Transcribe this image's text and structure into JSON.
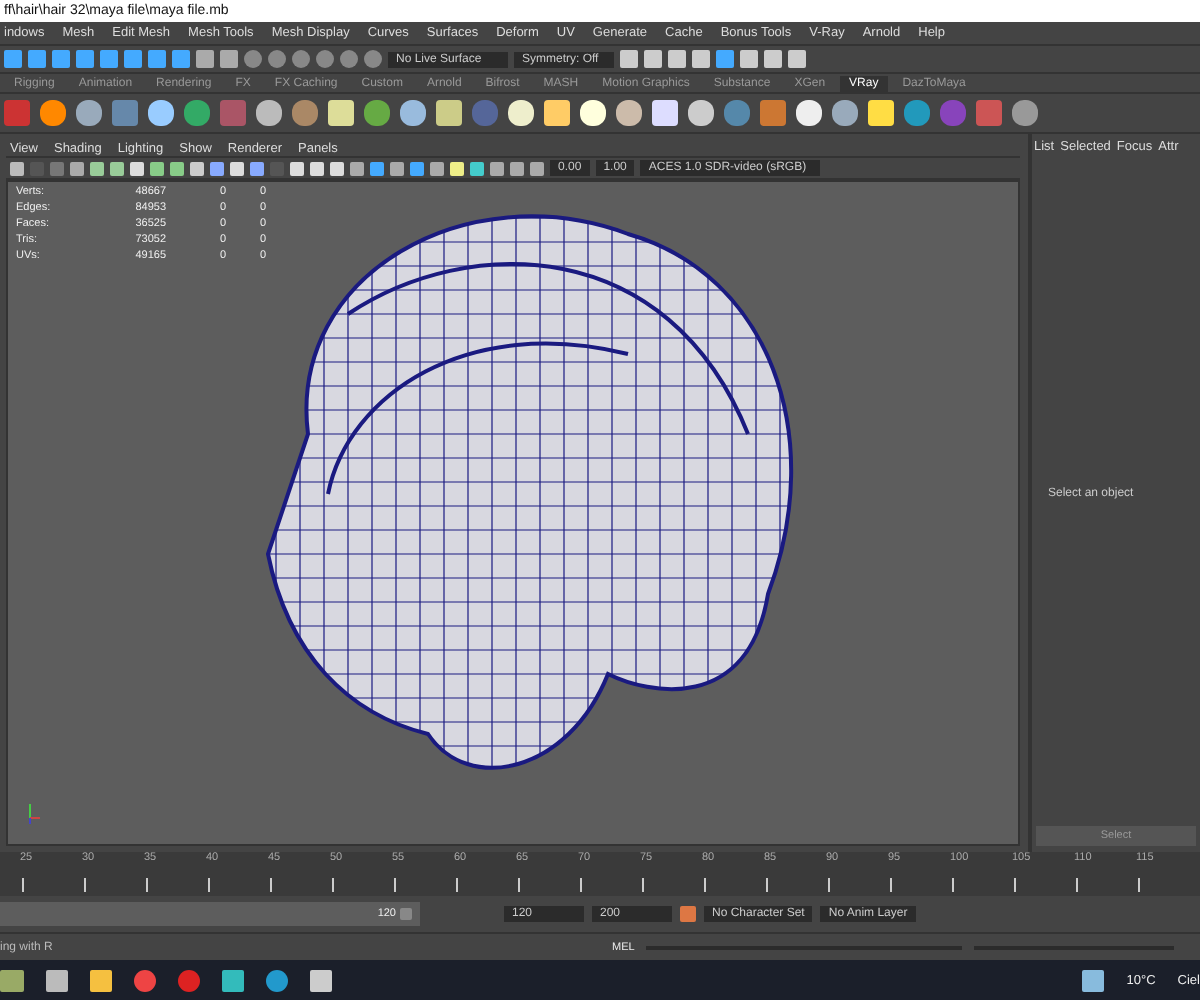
{
  "window": {
    "title": "ff\\hair\\hair 32\\maya file\\maya file.mb"
  },
  "menu": [
    "indows",
    "Mesh",
    "Edit Mesh",
    "Mesh Tools",
    "Mesh Display",
    "Curves",
    "Surfaces",
    "Deform",
    "UV",
    "Generate",
    "Cache",
    "Bonus Tools",
    "V-Ray",
    "Arnold",
    "Help"
  ],
  "status_line": {
    "live_surface": "No Live Surface",
    "symmetry": "Symmetry: Off"
  },
  "shelf_tabs": [
    {
      "label": "Rigging",
      "selected": false
    },
    {
      "label": "Animation",
      "selected": false
    },
    {
      "label": "Rendering",
      "selected": false
    },
    {
      "label": "FX",
      "selected": false
    },
    {
      "label": "FX Caching",
      "selected": false
    },
    {
      "label": "Custom",
      "selected": false
    },
    {
      "label": "Arnold",
      "selected": false
    },
    {
      "label": "Bifrost",
      "selected": false
    },
    {
      "label": "MASH",
      "selected": false
    },
    {
      "label": "Motion Graphics",
      "selected": false
    },
    {
      "label": "Substance",
      "selected": false
    },
    {
      "label": "XGen",
      "selected": false
    },
    {
      "label": "VRay",
      "selected": true
    },
    {
      "label": "DazToMaya",
      "selected": false
    }
  ],
  "viewport": {
    "menu": [
      "View",
      "Shading",
      "Lighting",
      "Show",
      "Renderer",
      "Panels"
    ],
    "exposure": "0.00",
    "gamma": "1.00",
    "color_space": "ACES 1.0 SDR-video (sRGB)",
    "stats": [
      {
        "label": "Verts:",
        "values": [
          "48667",
          "0",
          "0"
        ]
      },
      {
        "label": "Edges:",
        "values": [
          "84953",
          "0",
          "0"
        ]
      },
      {
        "label": "Faces:",
        "values": [
          "36525",
          "0",
          "0"
        ]
      },
      {
        "label": "Tris:",
        "values": [
          "73052",
          "0",
          "0"
        ]
      },
      {
        "label": "UVs:",
        "values": [
          "49165",
          "0",
          "0"
        ]
      }
    ]
  },
  "channel_box": {
    "tabs": [
      "List",
      "Selected",
      "Focus",
      "Attr"
    ],
    "message": "Select an object",
    "button": "Select"
  },
  "time_slider": {
    "ticks": [
      "25",
      "30",
      "35",
      "40",
      "45",
      "50",
      "55",
      "60",
      "65",
      "70",
      "75",
      "80",
      "85",
      "90",
      "95",
      "100",
      "105",
      "110",
      "115"
    ]
  },
  "range_slider": {
    "level": 1,
    "range_end": "120",
    "end": "120",
    "max": "200",
    "character_set": "No Character Set",
    "anim_layer": "No Anim Layer"
  },
  "command_line": {
    "help": "ing with R",
    "language": "MEL"
  },
  "taskbar": {
    "temperature": "10°C",
    "weather": "Ciel"
  }
}
